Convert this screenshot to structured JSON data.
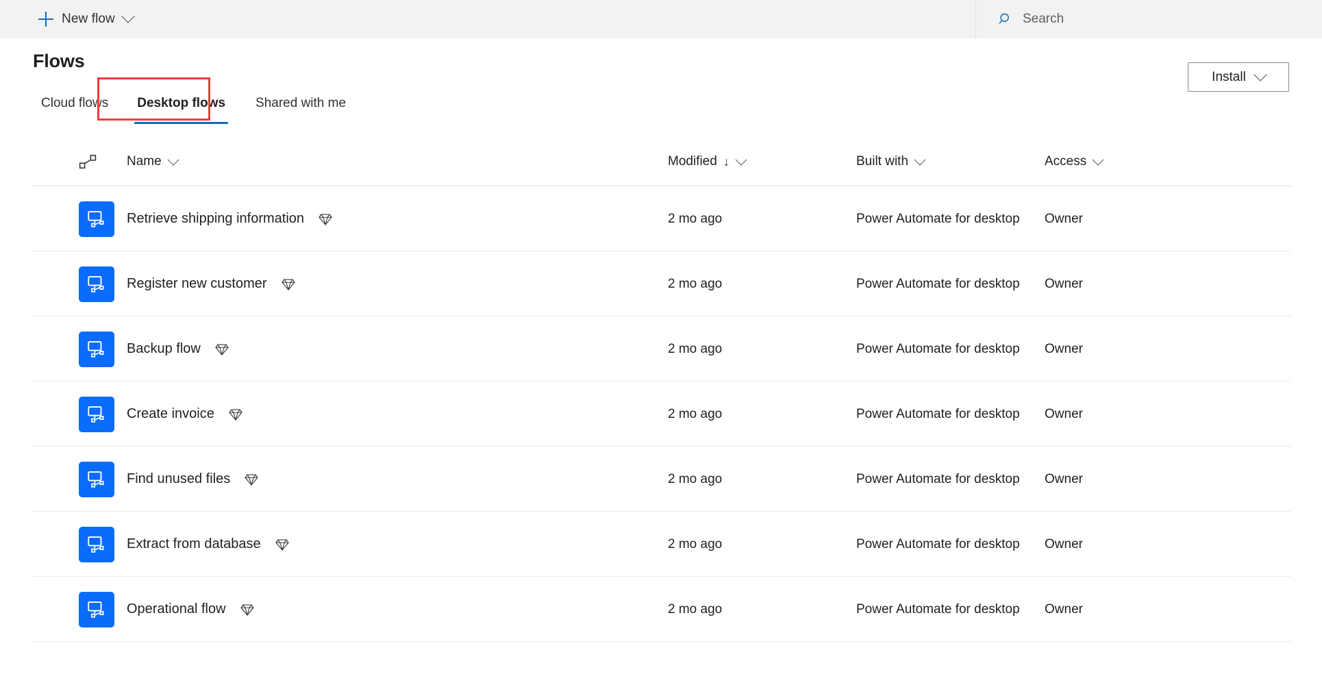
{
  "topbar": {
    "new_flow_label": "New flow",
    "new_flow_icon": "plus-icon",
    "new_flow_chevron": "chevron-down-icon",
    "search_placeholder": "Search",
    "search_value": "",
    "search_icon": "search-icon"
  },
  "header": {
    "page_title": "Flows",
    "install_label": "Install",
    "install_chevron": "chevron-down-icon"
  },
  "tabs": [
    {
      "label": "Cloud flows",
      "active": false
    },
    {
      "label": "Desktop flows",
      "active": true
    },
    {
      "label": "Shared with me",
      "active": false
    }
  ],
  "annotation": {
    "target": "Desktop flows",
    "color": "#f23b3b"
  },
  "colors": {
    "accent": "#0f6cbd",
    "tile_blue": "#0b6cfb",
    "annotation_red": "#f23b3b",
    "topbar_bg": "#f3f2f1",
    "row_divider": "#edebe9"
  },
  "table": {
    "columns": [
      {
        "key": "icon",
        "label": "",
        "icon": "flow-link-icon",
        "sortable": false
      },
      {
        "key": "name",
        "label": "Name",
        "chevron": "chevron-down-icon",
        "sorted": ""
      },
      {
        "key": "modified",
        "label": "Modified",
        "chevron": "chevron-down-icon",
        "sorted": "desc",
        "sort_glyph": "↓"
      },
      {
        "key": "built",
        "label": "Built with",
        "chevron": "chevron-down-icon",
        "sorted": ""
      },
      {
        "key": "access",
        "label": "Access",
        "chevron": "chevron-down-icon",
        "sorted": ""
      }
    ],
    "rows": [
      {
        "icon": "desktop-flow-icon",
        "name": "Retrieve shipping information",
        "badge": "premium-diamond-icon",
        "modified": "2 mo ago",
        "built_with": "Power Automate for desktop",
        "access": "Owner"
      },
      {
        "icon": "desktop-flow-icon",
        "name": "Register new customer",
        "badge": "premium-diamond-icon",
        "modified": "2 mo ago",
        "built_with": "Power Automate for desktop",
        "access": "Owner"
      },
      {
        "icon": "desktop-flow-icon",
        "name": "Backup flow",
        "badge": "premium-diamond-icon",
        "modified": "2 mo ago",
        "built_with": "Power Automate for desktop",
        "access": "Owner"
      },
      {
        "icon": "desktop-flow-icon",
        "name": "Create invoice",
        "badge": "premium-diamond-icon",
        "modified": "2 mo ago",
        "built_with": "Power Automate for desktop",
        "access": "Owner"
      },
      {
        "icon": "desktop-flow-icon",
        "name": "Find unused files",
        "badge": "premium-diamond-icon",
        "modified": "2 mo ago",
        "built_with": "Power Automate for desktop",
        "access": "Owner"
      },
      {
        "icon": "desktop-flow-icon",
        "name": "Extract from database",
        "badge": "premium-diamond-icon",
        "modified": "2 mo ago",
        "built_with": "Power Automate for desktop",
        "access": "Owner"
      },
      {
        "icon": "desktop-flow-icon",
        "name": "Operational flow",
        "badge": "premium-diamond-icon",
        "modified": "2 mo ago",
        "built_with": "Power Automate for desktop",
        "access": "Owner"
      }
    ]
  }
}
